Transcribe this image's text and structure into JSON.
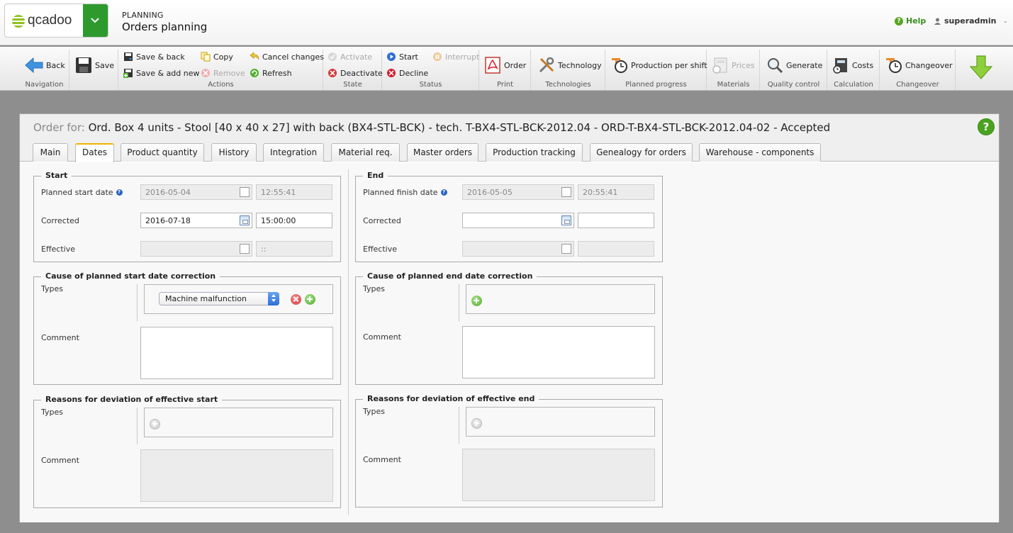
{
  "header": {
    "logo_text": "qcadoo",
    "module": "PLANNING",
    "page_title": "Orders planning",
    "help": "Help",
    "user": "superadmin"
  },
  "ribbon": {
    "groups": {
      "navigation": "Navigation",
      "actions": "Actions",
      "state": "State",
      "status": "Status",
      "print": "Print",
      "technologies": "Technologies",
      "planned_progress": "Planned progress",
      "materials": "Materials",
      "quality_control": "Quality control",
      "calculation": "Calculation",
      "changeover": "Changeover"
    },
    "buttons": {
      "back": "Back",
      "save": "Save",
      "save_back": "Save & back",
      "save_add_new": "Save & add new",
      "copy": "Copy",
      "remove": "Remove",
      "cancel_changes": "Cancel changes",
      "refresh": "Refresh",
      "activate": "Activate",
      "deactivate": "Deactivate",
      "start": "Start",
      "interrupt": "Interrupt",
      "decline": "Decline",
      "order": "Order",
      "technology": "Technology",
      "production_per_shift": "Production per shift",
      "prices": "Prices",
      "generate": "Generate",
      "costs": "Costs",
      "changeover": "Changeover"
    }
  },
  "panel": {
    "title_prefix": "Order for:",
    "title": "Ord. Box 4 units - Stool [40 x 40 x 27] with back (BX4-STL-BCK) - tech. T-BX4-STL-BCK-2012.04 - ORD-T-BX4-STL-BCK-2012.04-02 - Accepted",
    "tabs": [
      "Main",
      "Dates",
      "Product quantity",
      "History",
      "Integration",
      "Material req.",
      "Master orders",
      "Production tracking",
      "Genealogy for orders",
      "Warehouse - components"
    ],
    "active_tab": "Dates"
  },
  "start": {
    "legend": "Start",
    "planned_label": "Planned start date",
    "planned_date": "2016-05-04",
    "planned_time": "12:55:41",
    "corrected_label": "Corrected",
    "corrected_date": "2016-07-18",
    "corrected_time": "15:00:00",
    "effective_label": "Effective",
    "effective_date": "",
    "effective_time": "::"
  },
  "end": {
    "legend": "End",
    "planned_label": "Planned finish date",
    "planned_date": "2016-05-05",
    "planned_time": "20:55:41",
    "corrected_label": "Corrected",
    "corrected_date": "",
    "corrected_time": "",
    "effective_label": "Effective",
    "effective_date": "",
    "effective_time": ""
  },
  "cause_start": {
    "legend": "Cause of planned start date correction",
    "types_label": "Types",
    "selected_type": "Machine malfunction",
    "comment_label": "Comment"
  },
  "cause_end": {
    "legend": "Cause of planned end date correction",
    "types_label": "Types",
    "comment_label": "Comment"
  },
  "deviation_start": {
    "legend": "Reasons for deviation of effective start",
    "types_label": "Types",
    "comment_label": "Comment"
  },
  "deviation_end": {
    "legend": "Reasons for deviation of effective end",
    "types_label": "Types",
    "comment_label": "Comment"
  },
  "colors": {
    "accent_green": "#2e9a2e",
    "help_green": "#3a8e1f",
    "active_tab_border": "#f0b400"
  }
}
